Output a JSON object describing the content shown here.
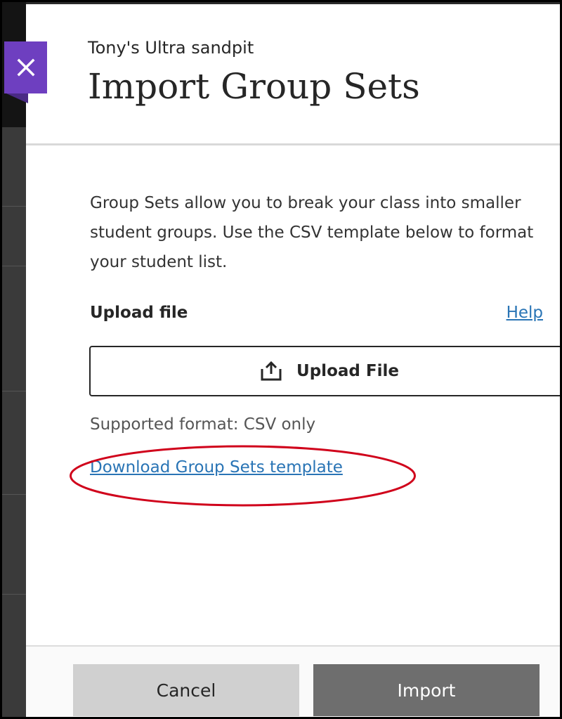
{
  "panel": {
    "course_name": "Tony's Ultra sandpit",
    "title": "Import Group Sets",
    "description": "Group Sets allow you to break your class into smaller student groups. Use the CSV template below to format your student list.",
    "upload_label": "Upload file",
    "help_link": "Help",
    "upload_button": "Upload File",
    "supported_format": "Supported format: CSV only",
    "download_link": "Download Group Sets template"
  },
  "footer": {
    "cancel_label": "Cancel",
    "import_label": "Import"
  },
  "icons": {
    "close": "close-icon",
    "upload": "upload-icon"
  },
  "colors": {
    "accent": "#6e3fc0",
    "link": "#2974b5",
    "annotation": "#d0021b",
    "import_button": "#6e6e6e",
    "cancel_button": "#d0d0d0"
  }
}
